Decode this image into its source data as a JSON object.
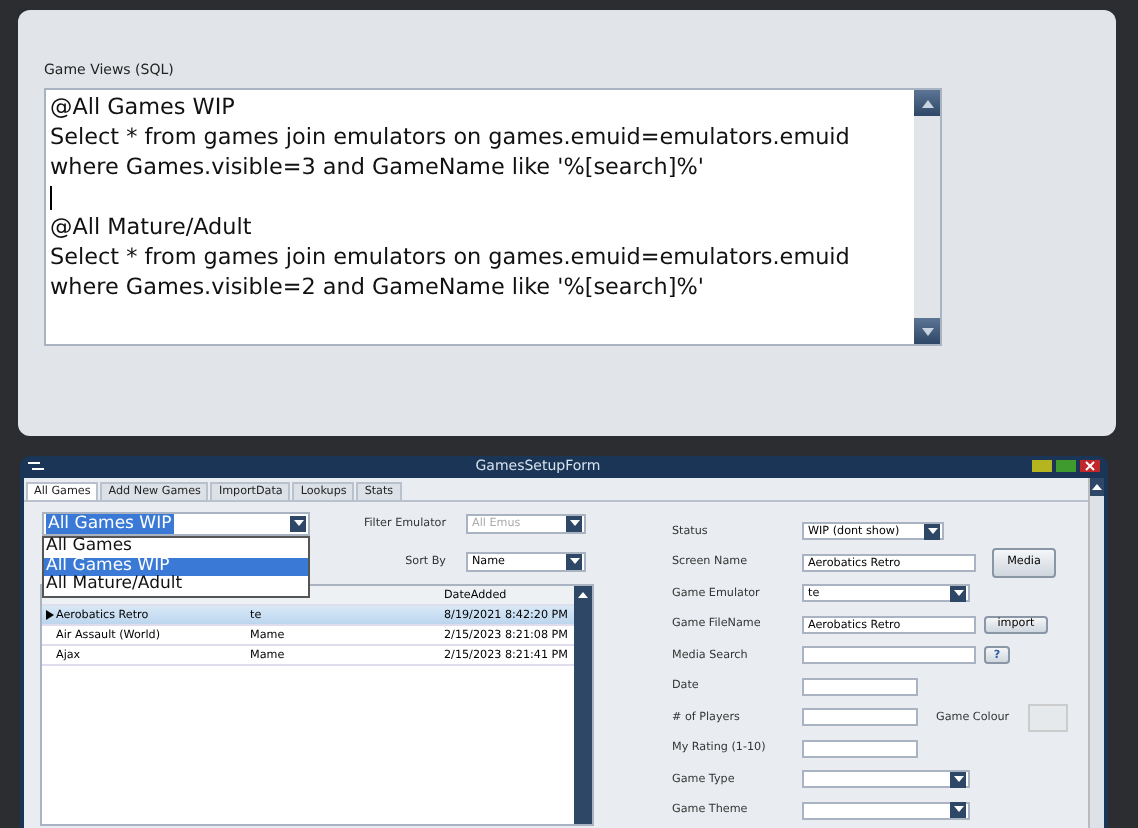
{
  "sql_panel": {
    "label": "Game Views (SQL)",
    "views": [
      {
        "name": "@All Games WIP",
        "query": [
          "Select * from games join emulators on games.emuid=emulators.emuid",
          "where Games.visible=3 and GameName like '%[search]%'"
        ]
      },
      {
        "name": "@All Mature/Adult",
        "query": [
          "Select * from games join emulators on games.emuid=emulators.emuid",
          "where Games.visible=2 and GameName like '%[search]%'"
        ]
      }
    ]
  },
  "window": {
    "title": "GamesSetupForm",
    "tabs": [
      {
        "label": "All Games",
        "selected": true
      },
      {
        "label": "Add New Games",
        "selected": false
      },
      {
        "label": "ImportData",
        "selected": false
      },
      {
        "label": "Lookups",
        "selected": false
      },
      {
        "label": "Stats",
        "selected": false
      }
    ],
    "view_dropdown": {
      "value": "All Games WIP",
      "expanded": true,
      "options": [
        {
          "label": "All Games",
          "selected": false
        },
        {
          "label": "All Games WIP",
          "selected": true
        },
        {
          "label": "All Mature/Adult",
          "selected": false
        }
      ]
    },
    "filter_emulator": {
      "label": "Filter Emulator",
      "placeholder": "All Emus"
    },
    "sort_by": {
      "label": "Sort By",
      "value": "Name"
    },
    "table": {
      "column_3": "DateAdded",
      "rows": [
        {
          "name": "Aerobatics Retro",
          "emulator": "te",
          "date": "8/19/2021 8:42:20 PM",
          "selected": true
        },
        {
          "name": "Air Assault (World)",
          "emulator": "Mame",
          "date": "2/15/2023 8:21:08 PM",
          "selected": false
        },
        {
          "name": "Ajax",
          "emulator": "Mame",
          "date": "2/15/2023 8:21:41 PM",
          "selected": false
        }
      ]
    },
    "fields": [
      {
        "kind": "dropdown",
        "label": "Status",
        "value": "WIP (dont show)"
      },
      {
        "kind": "text",
        "label": "Screen Name",
        "value": "Aerobatics Retro",
        "button": "Media"
      },
      {
        "kind": "dropdown",
        "label": "Game Emulator",
        "value": "te"
      },
      {
        "kind": "text",
        "label": "Game FileName",
        "value": "Aerobatics Retro",
        "button": "import"
      },
      {
        "kind": "text",
        "label": "Media Search",
        "button": "?"
      },
      {
        "kind": "text",
        "label": "Date"
      },
      {
        "kind": "text",
        "label": "# of Players",
        "extra_label": "Game Colour"
      },
      {
        "kind": "text",
        "label": "My Rating (1-10)"
      },
      {
        "kind": "dropdown",
        "label": "Game Type"
      },
      {
        "kind": "dropdown",
        "label": "Game Theme"
      }
    ]
  }
}
